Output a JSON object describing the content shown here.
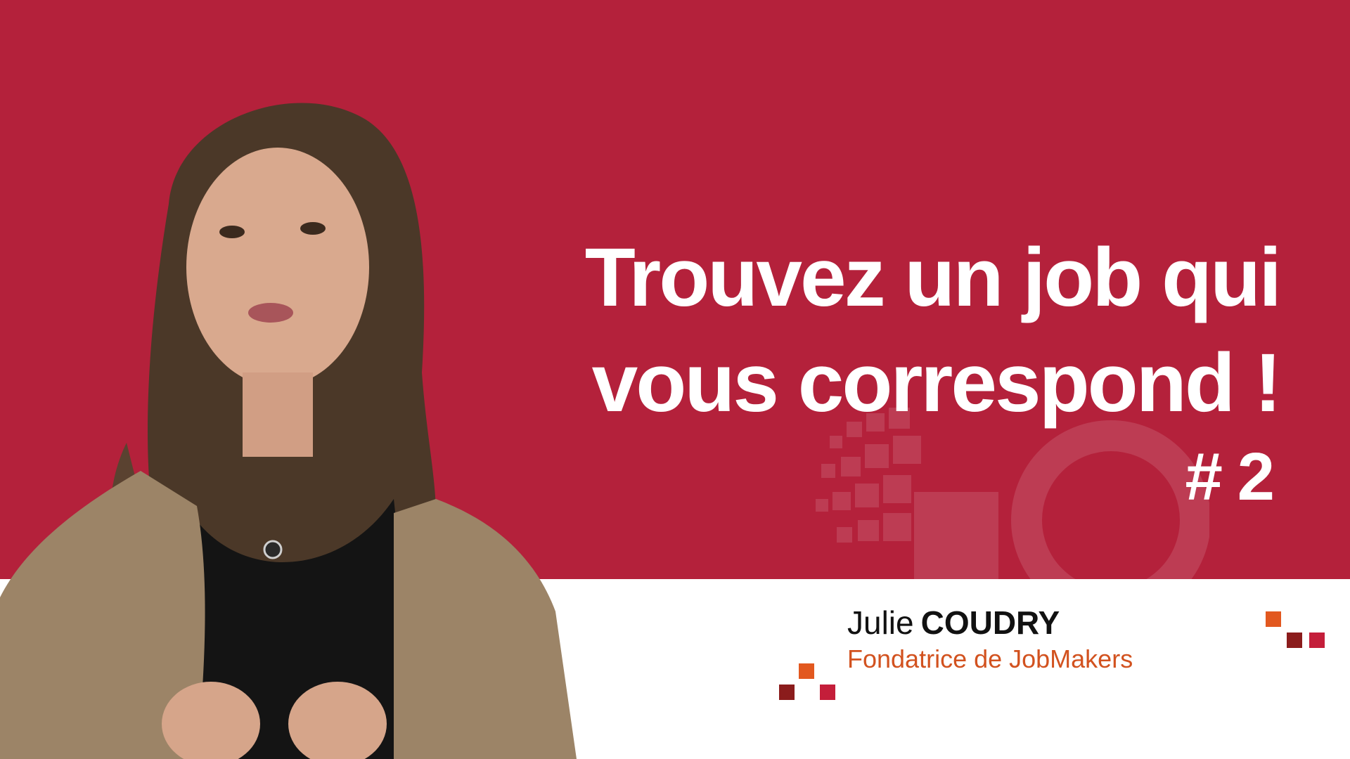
{
  "title": {
    "line1": "Trouvez un job qui",
    "line2": "vous correspond !",
    "episode": "# 2"
  },
  "presenter": {
    "first_name": "Julie",
    "last_name": "COUDRY",
    "role": "Fondatrice de JobMakers"
  },
  "colors": {
    "band_red": "#b4213b",
    "role_orange": "#d2521f",
    "deco_orange": "#e2581f",
    "deco_darkred": "#8b1c1c",
    "deco_red": "#c41e3a"
  }
}
